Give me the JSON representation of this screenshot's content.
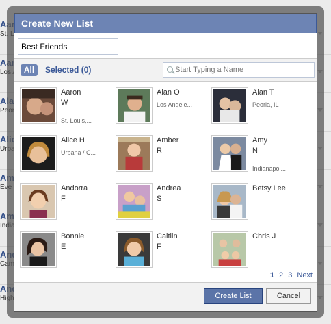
{
  "background": {
    "rows": [
      {
        "name": "Aar",
        "sub": "St. L"
      },
      {
        "name": "Aar",
        "sub": "Los A"
      },
      {
        "name": "Ala",
        "sub": "Peori"
      },
      {
        "name": "Alic",
        "sub": "Urba"
      },
      {
        "name": "Am",
        "sub": "Eve"
      },
      {
        "name": "Am",
        "sub": "India"
      },
      {
        "name": "And",
        "sub": "Cam"
      },
      {
        "name": "And",
        "sub": "High"
      }
    ]
  },
  "dialog": {
    "title": "Create New List",
    "list_name_value": "Best Friends",
    "tabs": {
      "all": "All",
      "selected": "Selected (0)"
    },
    "search_placeholder": "Start Typing a Name",
    "friends": [
      {
        "first": "Aaron",
        "last": "W",
        "location": "St. Louis,..."
      },
      {
        "first": "Alan O",
        "last": "",
        "location": "Los Angele..."
      },
      {
        "first": "Alan T",
        "last": "",
        "location": "Peoria, IL"
      },
      {
        "first": "Alice H",
        "last": "",
        "location": "Urbana / C..."
      },
      {
        "first": "Amber",
        "last": "R",
        "location": ""
      },
      {
        "first": "Amy",
        "last": "N",
        "location": "Indianapol..."
      },
      {
        "first": "Andorra",
        "last": "F",
        "location": ""
      },
      {
        "first": "Andrea",
        "last": "S",
        "location": ""
      },
      {
        "first": "Betsy Lee",
        "last": "",
        "location": ""
      },
      {
        "first": "Bonnie",
        "last": "E",
        "location": ""
      },
      {
        "first": "Caitlin",
        "last": "F",
        "location": ""
      },
      {
        "first": "Chris J",
        "last": "",
        "location": ""
      }
    ],
    "pager": {
      "pages": [
        "1",
        "2",
        "3"
      ],
      "current": "1",
      "next": "Next"
    },
    "buttons": {
      "create": "Create List",
      "cancel": "Cancel"
    }
  },
  "colors": {
    "title_bar": "#6d84b4",
    "link": "#3b5998",
    "primary_button": "#5b74a8"
  }
}
